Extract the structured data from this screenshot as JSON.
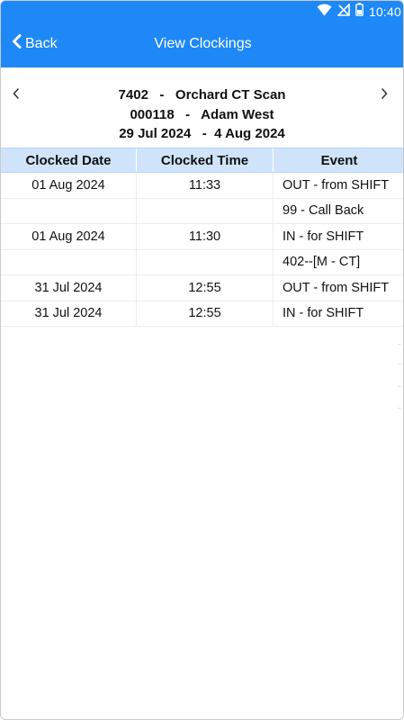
{
  "status_bar": {
    "time": "10:40",
    "icons": [
      "wifi-icon",
      "no-signal-icon",
      "battery-icon"
    ]
  },
  "app_bar": {
    "back_label": "Back",
    "title": "View Clockings",
    "color": "#1e88f7"
  },
  "header": {
    "line1": "7402   -   Orchard CT Scan",
    "line2": "000118   -   Adam West",
    "line3": "29 Jul 2024   -  4 Aug 2024"
  },
  "table": {
    "columns": [
      "Clocked Date",
      "Clocked Time",
      "Event"
    ],
    "header_color": "#cfe4fb",
    "rows": [
      {
        "date": "01 Aug 2024",
        "time": "11:33",
        "event": "OUT - from SHIFT"
      },
      {
        "date": "",
        "time": "",
        "event": "99 - Call Back"
      },
      {
        "date": "01 Aug 2024",
        "time": "11:30",
        "event": "IN - for SHIFT"
      },
      {
        "date": "",
        "time": "",
        "event": "402--[M - CT]"
      },
      {
        "date": "31 Jul 2024",
        "time": "12:55",
        "event": "OUT - from SHIFT"
      },
      {
        "date": "31 Jul 2024",
        "time": "12:55",
        "event": "IN - for SHIFT"
      }
    ]
  }
}
